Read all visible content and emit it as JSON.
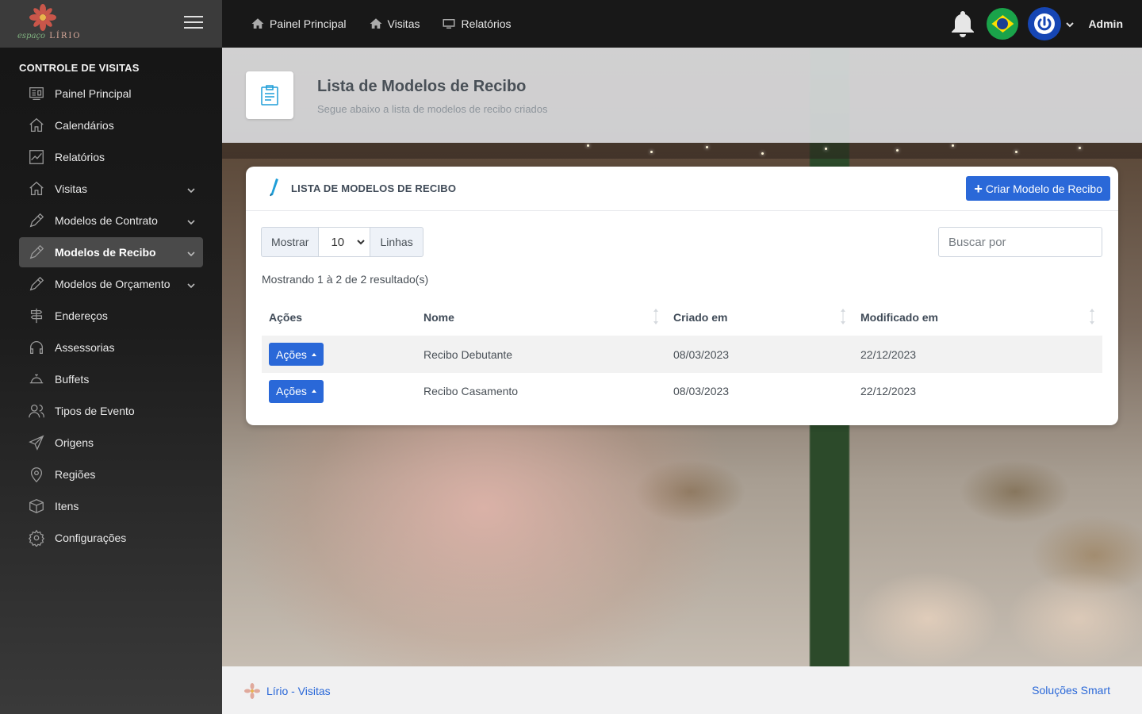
{
  "brand": {
    "logo_text": "LÍRIO",
    "logo_script": "espaço"
  },
  "sidebar": {
    "heading": "CONTROLE DE VISITAS",
    "items": [
      {
        "label": "Painel Principal",
        "icon": "dashboard-icon"
      },
      {
        "label": "Calendários",
        "icon": "home-icon"
      },
      {
        "label": "Relatórios",
        "icon": "chart-icon"
      },
      {
        "label": "Visitas",
        "icon": "home-icon",
        "expandable": true
      },
      {
        "label": "Modelos de Contrato",
        "icon": "pencil-icon",
        "expandable": true
      },
      {
        "label": "Modelos de Recibo",
        "icon": "pencil-icon",
        "expandable": true,
        "active": true
      },
      {
        "label": "Modelos de Orçamento",
        "icon": "pencil-icon",
        "expandable": true
      },
      {
        "label": "Endereços",
        "icon": "signpost-icon"
      },
      {
        "label": "Assessorias",
        "icon": "headset-icon"
      },
      {
        "label": "Buffets",
        "icon": "cloche-icon"
      },
      {
        "label": "Tipos de Evento",
        "icon": "users-icon"
      },
      {
        "label": "Origens",
        "icon": "send-icon"
      },
      {
        "label": "Regiões",
        "icon": "map-pin-icon"
      },
      {
        "label": "Itens",
        "icon": "box-icon"
      },
      {
        "label": "Configurações",
        "icon": "gear-icon"
      }
    ]
  },
  "topbar": {
    "links": [
      {
        "label": "Painel Principal",
        "icon": "home-icon"
      },
      {
        "label": "Visitas",
        "icon": "home-icon"
      },
      {
        "label": "Relatórios",
        "icon": "monitor-icon"
      }
    ],
    "user": "Admin",
    "language_flag": "brazil-flag-icon"
  },
  "header": {
    "title": "Lista de Modelos de Recibo",
    "subtitle": "Segue abaixo a lista de modelos de recibo criados"
  },
  "card": {
    "title": "LISTA DE MODELOS DE RECIBO",
    "create_button": "Criar Modelo de Recibo",
    "show_label": "Mostrar",
    "page_size": "10",
    "rows_label": "Linhas",
    "search_placeholder": "Buscar por",
    "info": "Mostrando 1 à 2 de 2 resultado(s)"
  },
  "table": {
    "columns": [
      "Ações",
      "Nome",
      "Criado em",
      "Modificado em"
    ],
    "rows": [
      {
        "action": "Ações",
        "nome": "Recibo Debutante",
        "criado": "08/03/2023",
        "modificado": "22/12/2023"
      },
      {
        "action": "Ações",
        "nome": "Recibo Casamento",
        "criado": "08/03/2023",
        "modificado": "22/12/2023"
      }
    ]
  },
  "footer": {
    "left": "Lírio - Visitas",
    "right": "Soluções Smart"
  },
  "colors": {
    "primary": "#2a68d8",
    "accent": "#1e9ed8",
    "sidebar": "#1c1c1c"
  }
}
